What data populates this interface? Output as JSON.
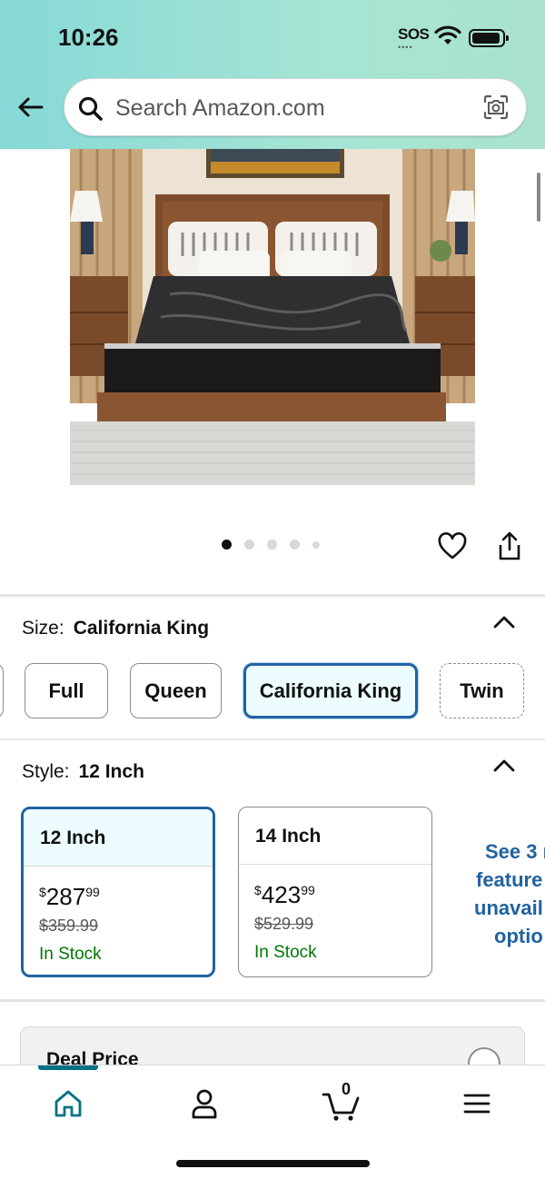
{
  "status_bar": {
    "time": "10:26",
    "sos": "SOS"
  },
  "search": {
    "placeholder": "Search Amazon.com"
  },
  "image_carousel": {
    "total": 5,
    "active": 1
  },
  "size": {
    "label": "Size:",
    "value": "California King",
    "options": [
      {
        "label": "Full",
        "selected": false,
        "available": true
      },
      {
        "label": "Queen",
        "selected": false,
        "available": true
      },
      {
        "label": "California King",
        "selected": true,
        "available": true
      },
      {
        "label": "Twin",
        "selected": false,
        "available": false
      }
    ]
  },
  "style": {
    "label": "Style:",
    "value": "12 Inch",
    "options": [
      {
        "label": "12 Inch",
        "price_symbol": "$",
        "price_whole": "287",
        "price_fraction": "99",
        "list_price": "$359.99",
        "stock": "In Stock",
        "selected": true
      },
      {
        "label": "14 Inch",
        "price_symbol": "$",
        "price_whole": "423",
        "price_fraction": "99",
        "list_price": "$529.99",
        "stock": "In Stock",
        "selected": false
      }
    ],
    "see_more_lines": [
      "See 3 r",
      "feature",
      "unavail",
      "optio"
    ]
  },
  "deal": {
    "label": "Deal Price"
  },
  "bottom_nav": {
    "cart_count": "0",
    "icons": [
      "home-icon",
      "account-icon",
      "cart-icon",
      "menu-icon"
    ]
  },
  "colors": {
    "accent": "#2162a1",
    "teal": "#007185",
    "in_stock": "#007600"
  }
}
